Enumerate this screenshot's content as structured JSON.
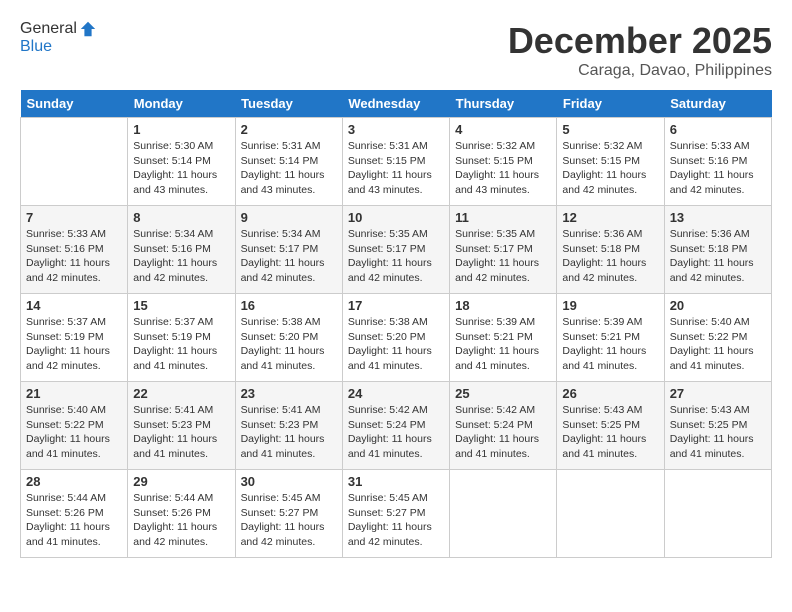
{
  "header": {
    "logo_line1": "General",
    "logo_line2": "Blue",
    "month": "December 2025",
    "location": "Caraga, Davao, Philippines"
  },
  "columns": [
    "Sunday",
    "Monday",
    "Tuesday",
    "Wednesday",
    "Thursday",
    "Friday",
    "Saturday"
  ],
  "weeks": [
    [
      {
        "day": "",
        "sunrise": "",
        "sunset": "",
        "daylight": ""
      },
      {
        "day": "1",
        "sunrise": "Sunrise: 5:30 AM",
        "sunset": "Sunset: 5:14 PM",
        "daylight": "Daylight: 11 hours and 43 minutes."
      },
      {
        "day": "2",
        "sunrise": "Sunrise: 5:31 AM",
        "sunset": "Sunset: 5:14 PM",
        "daylight": "Daylight: 11 hours and 43 minutes."
      },
      {
        "day": "3",
        "sunrise": "Sunrise: 5:31 AM",
        "sunset": "Sunset: 5:15 PM",
        "daylight": "Daylight: 11 hours and 43 minutes."
      },
      {
        "day": "4",
        "sunrise": "Sunrise: 5:32 AM",
        "sunset": "Sunset: 5:15 PM",
        "daylight": "Daylight: 11 hours and 43 minutes."
      },
      {
        "day": "5",
        "sunrise": "Sunrise: 5:32 AM",
        "sunset": "Sunset: 5:15 PM",
        "daylight": "Daylight: 11 hours and 42 minutes."
      },
      {
        "day": "6",
        "sunrise": "Sunrise: 5:33 AM",
        "sunset": "Sunset: 5:16 PM",
        "daylight": "Daylight: 11 hours and 42 minutes."
      }
    ],
    [
      {
        "day": "7",
        "sunrise": "Sunrise: 5:33 AM",
        "sunset": "Sunset: 5:16 PM",
        "daylight": "Daylight: 11 hours and 42 minutes."
      },
      {
        "day": "8",
        "sunrise": "Sunrise: 5:34 AM",
        "sunset": "Sunset: 5:16 PM",
        "daylight": "Daylight: 11 hours and 42 minutes."
      },
      {
        "day": "9",
        "sunrise": "Sunrise: 5:34 AM",
        "sunset": "Sunset: 5:17 PM",
        "daylight": "Daylight: 11 hours and 42 minutes."
      },
      {
        "day": "10",
        "sunrise": "Sunrise: 5:35 AM",
        "sunset": "Sunset: 5:17 PM",
        "daylight": "Daylight: 11 hours and 42 minutes."
      },
      {
        "day": "11",
        "sunrise": "Sunrise: 5:35 AM",
        "sunset": "Sunset: 5:17 PM",
        "daylight": "Daylight: 11 hours and 42 minutes."
      },
      {
        "day": "12",
        "sunrise": "Sunrise: 5:36 AM",
        "sunset": "Sunset: 5:18 PM",
        "daylight": "Daylight: 11 hours and 42 minutes."
      },
      {
        "day": "13",
        "sunrise": "Sunrise: 5:36 AM",
        "sunset": "Sunset: 5:18 PM",
        "daylight": "Daylight: 11 hours and 42 minutes."
      }
    ],
    [
      {
        "day": "14",
        "sunrise": "Sunrise: 5:37 AM",
        "sunset": "Sunset: 5:19 PM",
        "daylight": "Daylight: 11 hours and 42 minutes."
      },
      {
        "day": "15",
        "sunrise": "Sunrise: 5:37 AM",
        "sunset": "Sunset: 5:19 PM",
        "daylight": "Daylight: 11 hours and 41 minutes."
      },
      {
        "day": "16",
        "sunrise": "Sunrise: 5:38 AM",
        "sunset": "Sunset: 5:20 PM",
        "daylight": "Daylight: 11 hours and 41 minutes."
      },
      {
        "day": "17",
        "sunrise": "Sunrise: 5:38 AM",
        "sunset": "Sunset: 5:20 PM",
        "daylight": "Daylight: 11 hours and 41 minutes."
      },
      {
        "day": "18",
        "sunrise": "Sunrise: 5:39 AM",
        "sunset": "Sunset: 5:21 PM",
        "daylight": "Daylight: 11 hours and 41 minutes."
      },
      {
        "day": "19",
        "sunrise": "Sunrise: 5:39 AM",
        "sunset": "Sunset: 5:21 PM",
        "daylight": "Daylight: 11 hours and 41 minutes."
      },
      {
        "day": "20",
        "sunrise": "Sunrise: 5:40 AM",
        "sunset": "Sunset: 5:22 PM",
        "daylight": "Daylight: 11 hours and 41 minutes."
      }
    ],
    [
      {
        "day": "21",
        "sunrise": "Sunrise: 5:40 AM",
        "sunset": "Sunset: 5:22 PM",
        "daylight": "Daylight: 11 hours and 41 minutes."
      },
      {
        "day": "22",
        "sunrise": "Sunrise: 5:41 AM",
        "sunset": "Sunset: 5:23 PM",
        "daylight": "Daylight: 11 hours and 41 minutes."
      },
      {
        "day": "23",
        "sunrise": "Sunrise: 5:41 AM",
        "sunset": "Sunset: 5:23 PM",
        "daylight": "Daylight: 11 hours and 41 minutes."
      },
      {
        "day": "24",
        "sunrise": "Sunrise: 5:42 AM",
        "sunset": "Sunset: 5:24 PM",
        "daylight": "Daylight: 11 hours and 41 minutes."
      },
      {
        "day": "25",
        "sunrise": "Sunrise: 5:42 AM",
        "sunset": "Sunset: 5:24 PM",
        "daylight": "Daylight: 11 hours and 41 minutes."
      },
      {
        "day": "26",
        "sunrise": "Sunrise: 5:43 AM",
        "sunset": "Sunset: 5:25 PM",
        "daylight": "Daylight: 11 hours and 41 minutes."
      },
      {
        "day": "27",
        "sunrise": "Sunrise: 5:43 AM",
        "sunset": "Sunset: 5:25 PM",
        "daylight": "Daylight: 11 hours and 41 minutes."
      }
    ],
    [
      {
        "day": "28",
        "sunrise": "Sunrise: 5:44 AM",
        "sunset": "Sunset: 5:26 PM",
        "daylight": "Daylight: 11 hours and 41 minutes."
      },
      {
        "day": "29",
        "sunrise": "Sunrise: 5:44 AM",
        "sunset": "Sunset: 5:26 PM",
        "daylight": "Daylight: 11 hours and 42 minutes."
      },
      {
        "day": "30",
        "sunrise": "Sunrise: 5:45 AM",
        "sunset": "Sunset: 5:27 PM",
        "daylight": "Daylight: 11 hours and 42 minutes."
      },
      {
        "day": "31",
        "sunrise": "Sunrise: 5:45 AM",
        "sunset": "Sunset: 5:27 PM",
        "daylight": "Daylight: 11 hours and 42 minutes."
      },
      {
        "day": "",
        "sunrise": "",
        "sunset": "",
        "daylight": ""
      },
      {
        "day": "",
        "sunrise": "",
        "sunset": "",
        "daylight": ""
      },
      {
        "day": "",
        "sunrise": "",
        "sunset": "",
        "daylight": ""
      }
    ]
  ]
}
